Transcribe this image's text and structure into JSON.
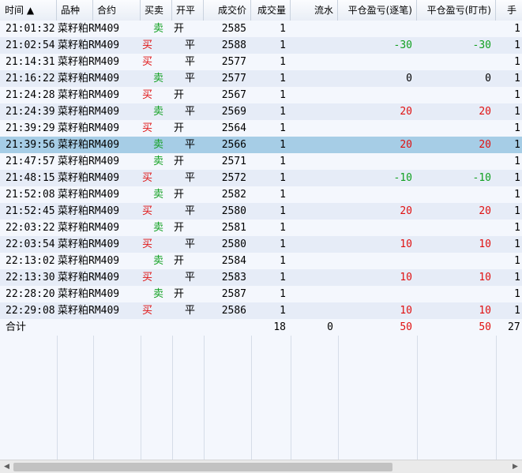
{
  "columns": {
    "time": "时间 ▲",
    "variety": "品种",
    "contract": "合约",
    "side": "买卖",
    "open_close": "开平",
    "price": "成交价",
    "volume": "成交量",
    "flow": "流水",
    "pnl_close": "平仓盈亏(逐笔)",
    "pnl_mark": "平仓盈亏(盯市)",
    "fee": "手"
  },
  "rows": [
    {
      "time": "21:01:32",
      "name": "菜籽粕RM409",
      "side": "卖",
      "oc": "开",
      "price": "2585",
      "vol": "1",
      "pnl1": "",
      "pnl2": "",
      "fee": "1",
      "side_color": "grn",
      "pnl_color": ""
    },
    {
      "time": "21:02:54",
      "name": "菜籽粕RM409",
      "side": "买",
      "oc": "平",
      "price": "2588",
      "vol": "1",
      "pnl1": "-30",
      "pnl2": "-30",
      "fee": "1",
      "side_color": "red",
      "pnl_color": "grn"
    },
    {
      "time": "21:14:31",
      "name": "菜籽粕RM409",
      "side": "买",
      "oc": "平",
      "price": "2577",
      "vol": "1",
      "pnl1": "",
      "pnl2": "",
      "fee": "1",
      "side_color": "red",
      "pnl_color": ""
    },
    {
      "time": "21:16:22",
      "name": "菜籽粕RM409",
      "side": "卖",
      "oc": "平",
      "price": "2577",
      "vol": "1",
      "pnl1": "0",
      "pnl2": "0",
      "fee": "1",
      "side_color": "grn",
      "pnl_color": ""
    },
    {
      "time": "21:24:28",
      "name": "菜籽粕RM409",
      "side": "买",
      "oc": "开",
      "price": "2567",
      "vol": "1",
      "pnl1": "",
      "pnl2": "",
      "fee": "1",
      "side_color": "red",
      "pnl_color": ""
    },
    {
      "time": "21:24:39",
      "name": "菜籽粕RM409",
      "side": "卖",
      "oc": "平",
      "price": "2569",
      "vol": "1",
      "pnl1": "20",
      "pnl2": "20",
      "fee": "1",
      "side_color": "grn",
      "pnl_color": "red"
    },
    {
      "time": "21:39:29",
      "name": "菜籽粕RM409",
      "side": "买",
      "oc": "开",
      "price": "2564",
      "vol": "1",
      "pnl1": "",
      "pnl2": "",
      "fee": "1",
      "side_color": "red",
      "pnl_color": ""
    },
    {
      "time": "21:39:56",
      "name": "菜籽粕RM409",
      "side": "卖",
      "oc": "平",
      "price": "2566",
      "vol": "1",
      "pnl1": "20",
      "pnl2": "20",
      "fee": "1",
      "side_color": "grn",
      "pnl_color": "red",
      "selected": true
    },
    {
      "time": "21:47:57",
      "name": "菜籽粕RM409",
      "side": "卖",
      "oc": "开",
      "price": "2571",
      "vol": "1",
      "pnl1": "",
      "pnl2": "",
      "fee": "1",
      "side_color": "grn",
      "pnl_color": ""
    },
    {
      "time": "21:48:15",
      "name": "菜籽粕RM409",
      "side": "买",
      "oc": "平",
      "price": "2572",
      "vol": "1",
      "pnl1": "-10",
      "pnl2": "-10",
      "fee": "1",
      "side_color": "red",
      "pnl_color": "grn"
    },
    {
      "time": "21:52:08",
      "name": "菜籽粕RM409",
      "side": "卖",
      "oc": "开",
      "price": "2582",
      "vol": "1",
      "pnl1": "",
      "pnl2": "",
      "fee": "1",
      "side_color": "grn",
      "pnl_color": ""
    },
    {
      "time": "21:52:45",
      "name": "菜籽粕RM409",
      "side": "买",
      "oc": "平",
      "price": "2580",
      "vol": "1",
      "pnl1": "20",
      "pnl2": "20",
      "fee": "1",
      "side_color": "red",
      "pnl_color": "red"
    },
    {
      "time": "22:03:22",
      "name": "菜籽粕RM409",
      "side": "卖",
      "oc": "开",
      "price": "2581",
      "vol": "1",
      "pnl1": "",
      "pnl2": "",
      "fee": "1",
      "side_color": "grn",
      "pnl_color": ""
    },
    {
      "time": "22:03:54",
      "name": "菜籽粕RM409",
      "side": "买",
      "oc": "平",
      "price": "2580",
      "vol": "1",
      "pnl1": "10",
      "pnl2": "10",
      "fee": "1",
      "side_color": "red",
      "pnl_color": "red"
    },
    {
      "time": "22:13:02",
      "name": "菜籽粕RM409",
      "side": "卖",
      "oc": "开",
      "price": "2584",
      "vol": "1",
      "pnl1": "",
      "pnl2": "",
      "fee": "1",
      "side_color": "grn",
      "pnl_color": ""
    },
    {
      "time": "22:13:30",
      "name": "菜籽粕RM409",
      "side": "买",
      "oc": "平",
      "price": "2583",
      "vol": "1",
      "pnl1": "10",
      "pnl2": "10",
      "fee": "1",
      "side_color": "red",
      "pnl_color": "red"
    },
    {
      "time": "22:28:20",
      "name": "菜籽粕RM409",
      "side": "卖",
      "oc": "开",
      "price": "2587",
      "vol": "1",
      "pnl1": "",
      "pnl2": "",
      "fee": "1",
      "side_color": "grn",
      "pnl_color": ""
    },
    {
      "time": "22:29:08",
      "name": "菜籽粕RM409",
      "side": "买",
      "oc": "平",
      "price": "2586",
      "vol": "1",
      "pnl1": "10",
      "pnl2": "10",
      "fee": "1",
      "side_color": "red",
      "pnl_color": "red"
    }
  ],
  "total": {
    "label": "合计",
    "vol": "18",
    "flow": "0",
    "pnl1": "50",
    "pnl2": "50",
    "fee": "27"
  },
  "scrollbar": {
    "left_icon": "arrow-left-icon",
    "right_icon": "arrow-right-icon",
    "left_glyph": "◀",
    "right_glyph": "▶"
  },
  "colors": {
    "buy_red": "#e01010",
    "sell_green": "#10a020",
    "selected_row": "#a6cde6",
    "alt_row": "#e6ecf7"
  }
}
